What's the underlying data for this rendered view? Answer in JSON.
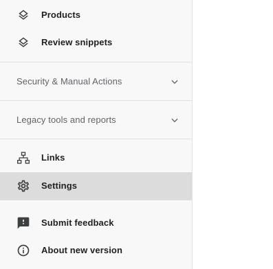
{
  "sidebar": {
    "top_items": [
      {
        "label": "Products",
        "icon": "layers-icon"
      },
      {
        "label": "Review snippets",
        "icon": "layers-icon"
      }
    ],
    "sections": [
      {
        "title": "Security & Manual Actions",
        "expanded": false
      },
      {
        "title": "Legacy tools and reports",
        "expanded": false
      }
    ],
    "bottom_items": [
      {
        "label": "Links",
        "icon": "sitemap-icon"
      },
      {
        "label": "Settings",
        "icon": "gear-icon",
        "active": true
      }
    ],
    "footer_items": [
      {
        "label": "Submit feedback",
        "icon": "feedback-icon"
      },
      {
        "label": "About new version",
        "icon": "info-icon"
      }
    ]
  },
  "colors": {
    "sidebar_bg": "#f8f8f8",
    "active_bg": "#dcdcdc",
    "text_primary": "#202124",
    "text_secondary": "#5f6368",
    "divider": "#e0e0e0"
  }
}
